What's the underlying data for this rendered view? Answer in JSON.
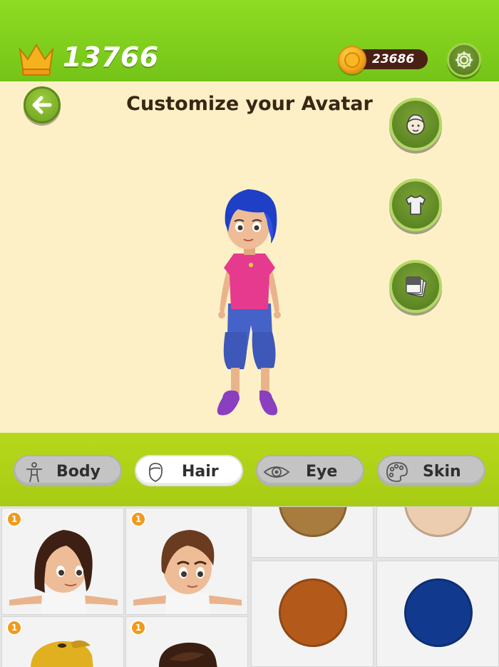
{
  "header": {
    "crown_score": "13766",
    "coins": "23686"
  },
  "screen": {
    "title": "Customize your Avatar"
  },
  "side_buttons": [
    {
      "icon": "face-icon"
    },
    {
      "icon": "shirt-icon"
    },
    {
      "icon": "cards-icon"
    }
  ],
  "tabs": [
    {
      "label": "Body",
      "icon": "body-icon",
      "active": false
    },
    {
      "label": "Hair",
      "icon": "head-outline-icon",
      "active": true
    },
    {
      "label": "Eye",
      "icon": "eye-icon",
      "active": false
    },
    {
      "label": "Skin",
      "icon": "palette-icon",
      "active": false
    }
  ],
  "hair_items": [
    {
      "badge": "1",
      "hair_color": "#3e1f14"
    },
    {
      "badge": "1",
      "hair_color": "#6a3b1f"
    },
    {
      "badge": "1",
      "hair_color": "#e0b020"
    },
    {
      "badge": "1",
      "hair_color": "#3a1e12"
    }
  ],
  "color_swatches": [
    {
      "color": "#a87b3e"
    },
    {
      "color": "#edcdb0"
    },
    {
      "color": "#b35a1b"
    },
    {
      "color": "#113a8f"
    }
  ],
  "colors": {
    "accent_green": "#74c418",
    "category_bar": "#b0d31a",
    "background": "#fdf0c6",
    "title_text": "#3a2614"
  }
}
